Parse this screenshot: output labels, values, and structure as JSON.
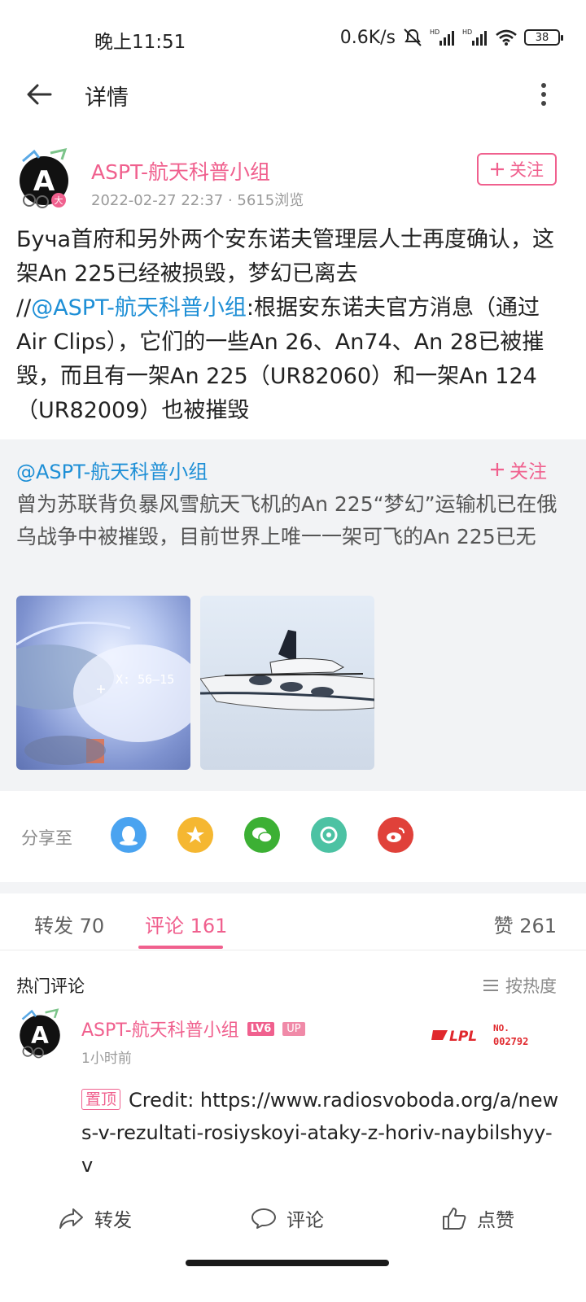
{
  "status_bar": {
    "time": "晚上11:51",
    "net_speed": "0.6K/s",
    "signal1_label": "HD",
    "signal2_label": "HD",
    "battery": "38"
  },
  "topbar": {
    "title": "详情"
  },
  "author": {
    "name": "ASPT-航天科普小组",
    "date": "2022-02-27 22:37",
    "separator": "·",
    "views": "5615浏览",
    "follow_label": "关注"
  },
  "post": {
    "line1": "Буча首府和另外两个安东诺夫管理层人士再度确认，这架An 225已经被损毁，梦幻已离去",
    "prefix": "//",
    "mention": "@ASPT-航天科普小组",
    "line2": ":根据安东诺夫官方消息（通过Air Clips），它们的一些An 26、An74、An 28已被摧毁，而且有一架An 225（UR82060）和一架An 124（UR82009）也被摧毁"
  },
  "repost": {
    "name": "@ASPT-航天科普小组",
    "follow_label": "关注",
    "text": "曾为苏联背负暴风雪航天飞机的An 225“梦幻”运输机已在俄乌战争中被摧毁，目前世界上唯一一架可飞的An 225已无",
    "image1_overlay": "X: 56—15"
  },
  "share": {
    "label": "分享至",
    "targets": [
      "qq-icon",
      "qzone-icon",
      "wechat-icon",
      "moments-icon",
      "weibo-icon"
    ]
  },
  "tabs": {
    "repost": "转发 70",
    "comments": "评论 161",
    "likes": "赞 261"
  },
  "comments": {
    "header": "热门评论",
    "sort_label": "按热度",
    "items": [
      {
        "name": "ASPT-航天科普小组",
        "level": "LV6",
        "up": "UP",
        "time": "1小时前",
        "medal_text": "LPL",
        "medal_no": "NO.",
        "medal_num": "002792",
        "pin": "置顶",
        "body": "Credit: https://www.radiosvoboda.org/a/news-v-rezultati-rosiyskoyi-ataky-z-horiv-naybilshyy-v"
      }
    ]
  },
  "actionbar": {
    "repost": "转发",
    "comment": "评论",
    "like": "点赞"
  },
  "colors": {
    "accent": "#f0608e",
    "link": "#1e8fd6",
    "repost_bg": "#f2f3f5"
  }
}
